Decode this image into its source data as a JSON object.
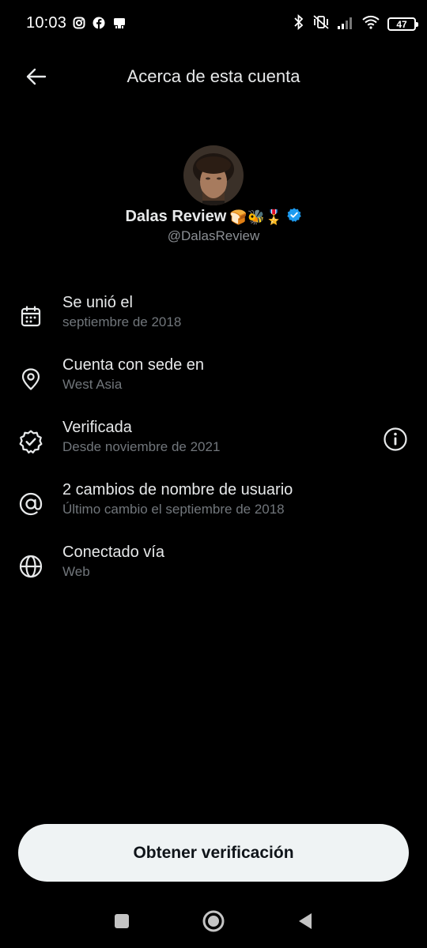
{
  "status_bar": {
    "time": "10:03",
    "left_icons": [
      "instagram-icon",
      "facebook-icon",
      "notification-app-icon"
    ],
    "right_icons": [
      "bluetooth-icon",
      "vibrate-off-icon",
      "cellular-signal-icon",
      "wifi-icon"
    ],
    "battery": "47"
  },
  "header": {
    "title": "Acerca de esta cuenta",
    "back_icon": "arrow-left-icon"
  },
  "profile": {
    "name": "Dalas Review",
    "emojis": "🍞🐝🎖️",
    "handle": "@DalasReview",
    "verified_color": "#1d9bf0"
  },
  "info": [
    {
      "icon": "calendar-icon",
      "title": "Se unió el",
      "subtitle": "septiembre de 2018"
    },
    {
      "icon": "location-pin-icon",
      "title": "Cuenta con sede en",
      "subtitle": "West Asia"
    },
    {
      "icon": "verified-badge-icon",
      "title": "Verificada",
      "subtitle": "Desde noviembre de 2021"
    },
    {
      "icon": "at-sign-icon",
      "title": "2 cambios de nombre de usuario",
      "subtitle": "Último cambio el septiembre de 2018"
    },
    {
      "icon": "globe-icon",
      "title": "Conectado vía",
      "subtitle": "Web"
    }
  ],
  "cta": {
    "label": "Obtener verificación"
  },
  "navbar": [
    "recent-apps-icon",
    "home-icon",
    "back-triangle-icon"
  ],
  "colors": {
    "background": "#000000",
    "primary_text": "#e7e9ea",
    "secondary_text": "#71767b",
    "button_bg": "#eff3f4",
    "button_text": "#0f1419"
  }
}
